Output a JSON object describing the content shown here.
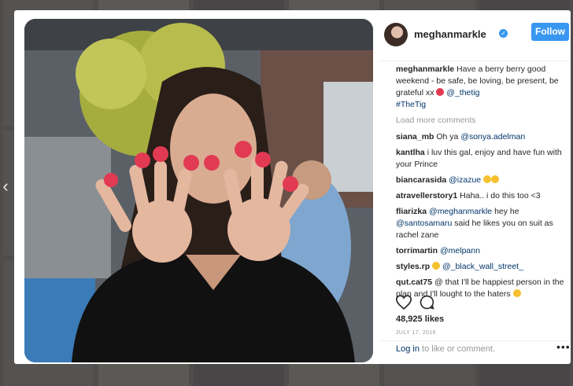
{
  "post": {
    "username": "meghanmarkle",
    "follow_label": "Follow",
    "caption_user": "meghanmarkle",
    "caption_text": "Have a berry berry good weekend - be safe, be loving, be present, be grateful xx",
    "caption_tag1": "@_thetig",
    "caption_tag2": "#TheTig",
    "load_more": "Load more comments",
    "likes": "48,925 likes",
    "date": "JULY 17, 2016"
  },
  "comments": [
    {
      "user": "siana_mb",
      "text": "Oh ya",
      "tag": "@sonya.adelman",
      "after": ""
    },
    {
      "user": "kantlha",
      "text": "i luv this gal, enjoy and have fun with your Prince",
      "tag": "",
      "after": ""
    },
    {
      "user": "biancarasida",
      "text": "",
      "tag": "@izazue",
      "after": ""
    },
    {
      "user": "atravellerstory1",
      "text": "Haha.. i do this too <3",
      "tag": "",
      "after": ""
    },
    {
      "user": "fliarizka",
      "text": "",
      "tag": "@meghanmarkle",
      "after": "hey he"
    },
    {
      "user": "",
      "text": "",
      "tag": "@santosamaru",
      "after": "said he likes you on suit as rachel zane"
    },
    {
      "user": "torrimartin",
      "text": "",
      "tag": "@melpann",
      "after": ""
    },
    {
      "user": "styles.rp",
      "text": "",
      "tag": "@_black_wall_street_",
      "after": ""
    },
    {
      "user": "qut.cat75",
      "text": "@ that I'll be happiest person in the plan and I'll lought to the haters",
      "tag": "",
      "after": ""
    }
  ],
  "footer": {
    "login_link": "Log in",
    "login_text": "to like or comment.",
    "more": "•••"
  },
  "nav": {
    "prev": "‹"
  },
  "icons": {
    "verified": "verified-badge-icon",
    "like": "heart-icon",
    "comment": "comment-bubble-icon",
    "more": "more-options-icon",
    "prev": "chevron-left-icon"
  },
  "colors": {
    "accent": "#3897f0",
    "link": "#003569",
    "muted": "#999999",
    "text": "#262626"
  }
}
